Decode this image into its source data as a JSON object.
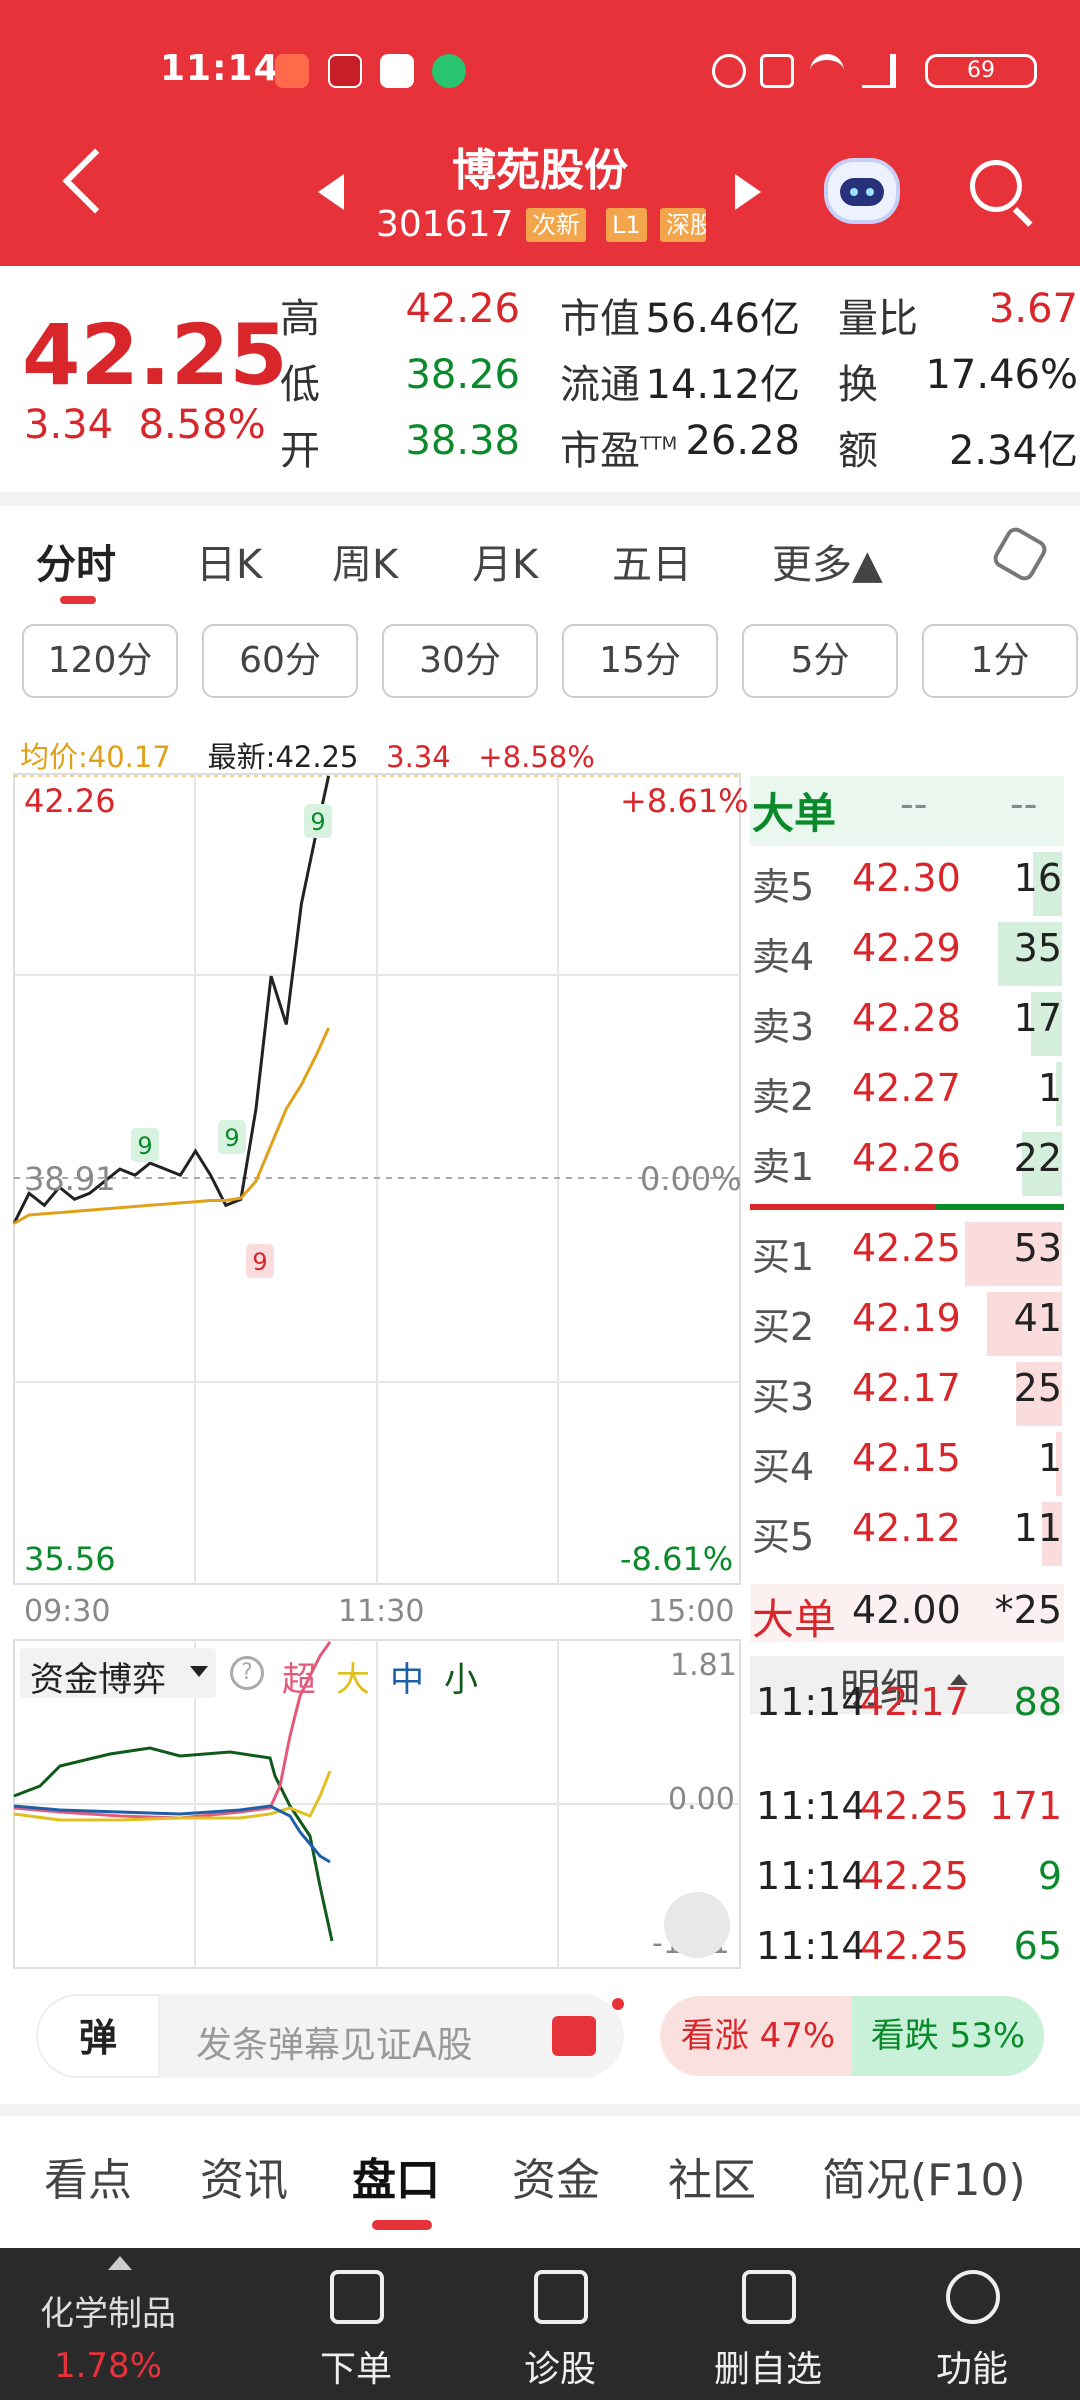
{
  "status": {
    "time": "11:14",
    "battery": "69"
  },
  "header": {
    "title": "博苑股份",
    "code": "301617",
    "tags": [
      "次新",
      "L1",
      "深股"
    ]
  },
  "quote": {
    "price": "42.25",
    "change": "3.34",
    "change_pct": "8.58%",
    "labels": {
      "high": "高",
      "low": "低",
      "open": "开",
      "mktcap": "市值",
      "float": "流通",
      "pe": "市盈",
      "pe_sup": "TTM",
      "vol_ratio": "量比",
      "turnover": "换",
      "amount": "额"
    },
    "high": "42.26",
    "low": "38.26",
    "open": "38.38",
    "mktcap": "56.46亿",
    "float": "14.12亿",
    "pe": "26.28",
    "vol_ratio": "3.67",
    "turnover": "17.46%",
    "amount": "2.34亿"
  },
  "period_tabs": [
    "分时",
    "日K",
    "周K",
    "月K",
    "五日",
    "更多▲"
  ],
  "minute_buttons": [
    "120分",
    "60分",
    "30分",
    "15分",
    "5分",
    "1分"
  ],
  "chart_info": {
    "avg_label": "均价:40.17",
    "last_label": "最新:42.25",
    "chg": "3.34",
    "pct": "+8.58%"
  },
  "chart_axes": {
    "y_top": "42.26",
    "y_mid": "38.91",
    "y_bot": "35.56",
    "pct_top": "+8.61%",
    "pct_mid": "0.00%",
    "pct_bot": "-8.61%",
    "x_start": "09:30",
    "x_mid": "11:30",
    "x_end": "15:00"
  },
  "chart_data": {
    "type": "line",
    "ylim": [
      35.56,
      42.26
    ],
    "x": [
      "09:30",
      "09:35",
      "09:40",
      "09:45",
      "09:50",
      "09:55",
      "10:00",
      "10:05",
      "10:10",
      "10:15",
      "10:20",
      "10:25",
      "10:30",
      "10:35",
      "10:40",
      "10:45",
      "10:50",
      "10:55",
      "11:00",
      "11:05",
      "11:10",
      "11:14"
    ],
    "series": [
      {
        "values": [
          38.55,
          38.8,
          38.7,
          38.85,
          38.75,
          38.8,
          38.9,
          39.0,
          38.95,
          39.05,
          39.0,
          38.95,
          39.15,
          38.95,
          38.7,
          38.75,
          39.5,
          40.6,
          40.2,
          41.2,
          41.8,
          42.26
        ],
        "color": "#222"
      },
      {
        "values": [
          38.55,
          38.62,
          38.63,
          38.64,
          38.65,
          38.66,
          38.67,
          38.68,
          38.69,
          38.7,
          38.71,
          38.72,
          38.73,
          38.74,
          38.74,
          38.76,
          38.9,
          39.2,
          39.5,
          39.7,
          39.95,
          40.17
        ],
        "color": "#e0a019"
      }
    ],
    "markers": [
      "9",
      "9",
      "9",
      "9"
    ]
  },
  "orderbook": {
    "big_label": "大单",
    "big_vals": [
      "--",
      "--"
    ],
    "asks": [
      {
        "l": "卖5",
        "p": "42.30",
        "v": "16"
      },
      {
        "l": "卖4",
        "p": "42.29",
        "v": "35"
      },
      {
        "l": "卖3",
        "p": "42.28",
        "v": "17"
      },
      {
        "l": "卖2",
        "p": "42.27",
        "v": "1"
      },
      {
        "l": "卖1",
        "p": "42.26",
        "v": "22"
      }
    ],
    "bids": [
      {
        "l": "买1",
        "p": "42.25",
        "v": "53"
      },
      {
        "l": "买2",
        "p": "42.19",
        "v": "41"
      },
      {
        "l": "买3",
        "p": "42.17",
        "v": "25"
      },
      {
        "l": "买4",
        "p": "42.15",
        "v": "1"
      },
      {
        "l": "买5",
        "p": "42.12",
        "v": "11"
      }
    ],
    "big2_label": "大单",
    "big2_price": "42.00",
    "big2_vol": "*25"
  },
  "fund": {
    "title": "资金博弈",
    "legend": [
      "超",
      "大",
      "中",
      "小"
    ],
    "y_top": "1.81",
    "y_mid": "0.00",
    "y_bot": "-1.81"
  },
  "detail": {
    "title": "明细",
    "rows": [
      {
        "t": "11:14",
        "p": "42.17",
        "v": "88"
      },
      {
        "t": "11:14",
        "p": "42.25",
        "v": "171"
      },
      {
        "t": "11:14",
        "p": "42.25",
        "v": "9"
      },
      {
        "t": "11:14",
        "p": "42.25",
        "v": "65"
      }
    ]
  },
  "danmu": {
    "icon": "弹",
    "placeholder": "发条弹幕见证A股",
    "bull": "看涨 47%",
    "bear": "看跌 53%"
  },
  "bottom_tabs": [
    "看点",
    "资讯",
    "盘口",
    "资金",
    "社区",
    "简况(F10)"
  ],
  "nav": {
    "sector": "化学制品",
    "sector_pct": "1.78%",
    "items": [
      "下单",
      "诊股",
      "删自选",
      "功能"
    ]
  },
  "colors": {
    "red": "#e8323a",
    "up": "#d8262a",
    "down": "#0a8a2a"
  }
}
